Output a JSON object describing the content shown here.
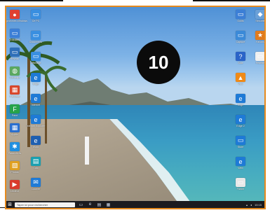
{
  "badge": {
    "number": "10"
  },
  "left_icons": [
    {
      "name": "chrome-icon",
      "label": "Programmes\nWindows",
      "color": "#e04030",
      "glyph": "●"
    },
    {
      "name": "folder-icon",
      "label": "Ordinateur",
      "color": "#3c7fd6",
      "glyph": "▭"
    },
    {
      "name": "network-icon",
      "label": "Réseau",
      "color": "#2f6fb8",
      "glyph": "▭"
    },
    {
      "name": "recycle-bin-icon",
      "label": "Corbeille",
      "color": "#5aa860",
      "glyph": "◍"
    },
    {
      "name": "control-panel-icon",
      "label": "Panneau",
      "color": "#d9472b",
      "glyph": "▦"
    },
    {
      "name": "paint-icon",
      "label": "Paint",
      "color": "#26a34a",
      "glyph": "F"
    },
    {
      "name": "app-icon",
      "label": "Applis",
      "color": "#2a6fd0",
      "glyph": "▦"
    },
    {
      "name": "settings-icon",
      "label": "Paramètres",
      "color": "#1f8fe0",
      "glyph": "✱"
    },
    {
      "name": "photos-icon",
      "label": "Photos",
      "color": "#e0a020",
      "glyph": "▧"
    },
    {
      "name": "media-icon",
      "label": "Lecteur",
      "color": "#d93b2b",
      "glyph": "▶"
    }
  ],
  "left_icons2": [
    {
      "name": "pc-icon",
      "label": "Ce PC",
      "color": "#3a8fe0",
      "glyph": "▭"
    },
    {
      "name": "documents-icon",
      "label": "Documents",
      "color": "#3a8fe0",
      "glyph": "▭"
    },
    {
      "name": "display-icon",
      "label": "Affichage",
      "color": "#3a8fe0",
      "glyph": "▭"
    },
    {
      "name": "edge-icon",
      "label": "Edge",
      "color": "#1e7ad6",
      "glyph": "e"
    },
    {
      "name": "edge-icon",
      "label": "Internet",
      "color": "#1e7ad6",
      "glyph": "e"
    },
    {
      "name": "ie-icon",
      "label": "Internet Explorer",
      "color": "#1e7ad6",
      "glyph": "e"
    },
    {
      "name": "word-icon",
      "label": "Word",
      "color": "#1e5fb0",
      "glyph": "e"
    },
    {
      "name": "calculator-icon",
      "label": "Calc",
      "color": "#1aa0b0",
      "glyph": "▤"
    },
    {
      "name": "mail-icon",
      "label": "Courrier",
      "color": "#1e7ad6",
      "glyph": "✉"
    }
  ],
  "right_icons": [
    {
      "name": "folder-icon",
      "label": "Outils",
      "color": "#3c7fd6",
      "glyph": "▭"
    },
    {
      "name": "screenshot-icon",
      "label": "Capture",
      "color": "#3b8ad8",
      "glyph": "▭"
    },
    {
      "name": "help-icon",
      "label": "Aide",
      "color": "#2a63c8",
      "glyph": "?"
    },
    {
      "name": "vlc-icon",
      "label": "VLC",
      "color": "#f08a16",
      "glyph": "▲"
    },
    {
      "name": "edge-icon",
      "label": "Edge",
      "color": "#1e7ad6",
      "glyph": "e"
    },
    {
      "name": "edge-icon",
      "label": "Edge 2",
      "color": "#1e7ad6",
      "glyph": "e"
    },
    {
      "name": "store-icon",
      "label": "Store",
      "color": "#1e7ad6",
      "glyph": "▭"
    },
    {
      "name": "edge-icon",
      "label": "Web",
      "color": "#1e7ad6",
      "glyph": "e"
    },
    {
      "name": "file-icon",
      "label": "Fichier",
      "color": "#e8e8e8",
      "glyph": "▭"
    }
  ],
  "right_icons2": [
    {
      "name": "shield-icon",
      "label": "Sécurité",
      "color": "#6aa0d8",
      "glyph": "◆"
    },
    {
      "name": "star-icon",
      "label": "Favoris",
      "color": "#e07b1e",
      "glyph": "★"
    },
    {
      "name": "window-icon",
      "label": "Fenêtre",
      "color": "#f0f0f0",
      "glyph": "▭"
    }
  ],
  "taskbar": {
    "search_placeholder": "Taper ici pour rechercher",
    "clock": "10:15"
  }
}
